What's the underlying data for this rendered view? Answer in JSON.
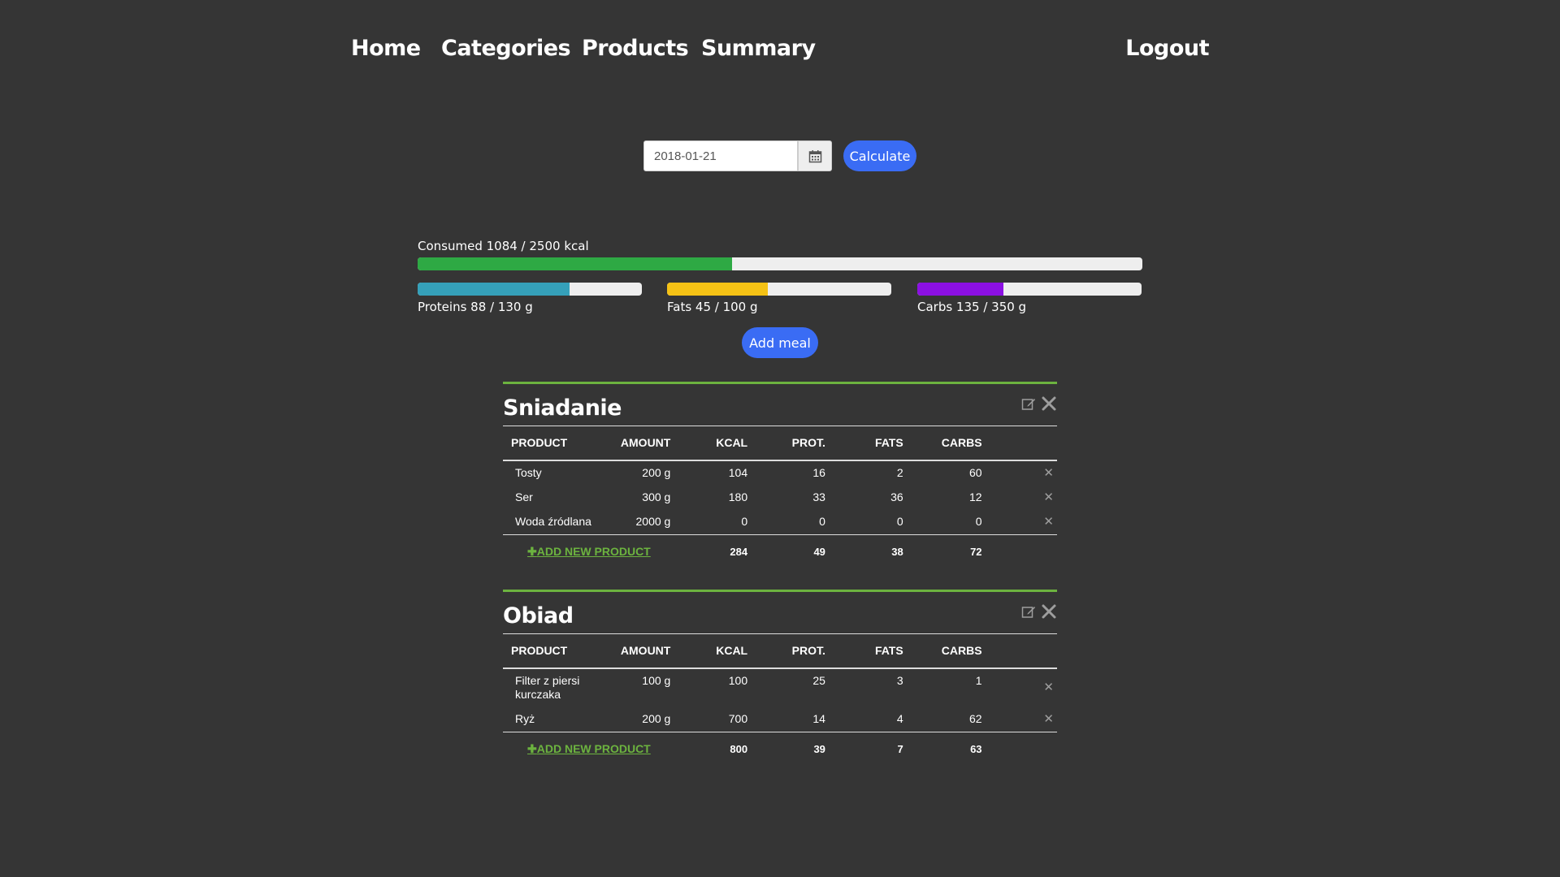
{
  "nav": {
    "home": "Home",
    "categories": "Categories",
    "products": "Products",
    "summary": "Summary",
    "logout": "Logout"
  },
  "date_picker": {
    "value": "2018-01-21",
    "icon": "calendar-icon"
  },
  "calculate_label": "Calculate",
  "consumed": {
    "label": "Consumed 1084 / 2500 kcal",
    "value": 1084,
    "goal": 2500,
    "color": "#2ea944"
  },
  "macros": [
    {
      "label": "Proteins 88 / 130 g",
      "value": 88,
      "goal": 130,
      "color": "#35a0b9"
    },
    {
      "label": "Fats 45 / 100 g",
      "value": 45,
      "goal": 100,
      "color": "#f5c215"
    },
    {
      "label": "Carbs 135 / 350 g",
      "value": 135,
      "goal": 350,
      "color": "#8b10e3"
    }
  ],
  "add_meal_label": "Add meal",
  "columns": [
    "PRODUCT",
    "AMOUNT",
    "KCAL",
    "PROT.",
    "FATS",
    "CARBS"
  ],
  "meals": [
    {
      "name": "Sniadanie",
      "products": [
        {
          "name": "Tosty",
          "amount": "200 g",
          "kcal": "104",
          "prot": "16",
          "fats": "2",
          "carbs": "60"
        },
        {
          "name": "Ser",
          "amount": "300 g",
          "kcal": "180",
          "prot": "33",
          "fats": "36",
          "carbs": "12"
        },
        {
          "name": "Woda źródlana",
          "amount": "2000 g",
          "kcal": "0",
          "prot": "0",
          "fats": "0",
          "carbs": "0"
        }
      ],
      "add_product_label": "ADD NEW PRODUCT",
      "totals": {
        "kcal": "284",
        "prot": "49",
        "fats": "38",
        "carbs": "72"
      }
    },
    {
      "name": "Obiad",
      "products": [
        {
          "name": "Filter z piersi kurczaka",
          "amount": "100 g",
          "kcal": "100",
          "prot": "25",
          "fats": "3",
          "carbs": "1"
        },
        {
          "name": "Ryż",
          "amount": "200 g",
          "kcal": "700",
          "prot": "14",
          "fats": "4",
          "carbs": "62"
        }
      ],
      "add_product_label": "ADD NEW PRODUCT",
      "totals": {
        "kcal": "800",
        "prot": "39",
        "fats": "7",
        "carbs": "63"
      }
    }
  ],
  "colors": {
    "accent_blue": "#3a6cf4",
    "accent_green": "#6cb33f",
    "background": "#353535"
  }
}
